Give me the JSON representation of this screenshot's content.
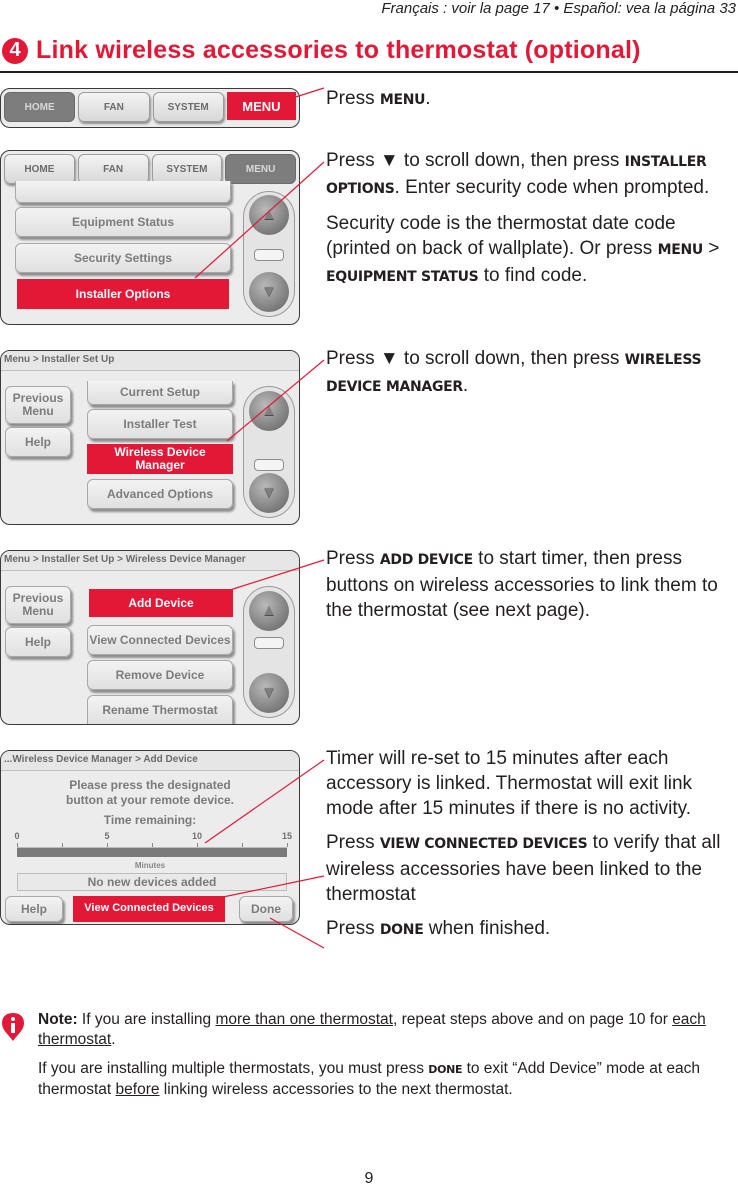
{
  "header": {
    "language_note": "Français : voir la page 17  •  Español: vea la página 33",
    "step_number": "4",
    "title": "Link wireless accessories to thermostat (optional)"
  },
  "screens": {
    "s1": {
      "tabs": [
        "HOME",
        "FAN",
        "SYSTEM",
        "MENU"
      ],
      "highlighted_tab": "MENU"
    },
    "s2": {
      "tabs": [
        "HOME",
        "FAN",
        "SYSTEM",
        "MENU"
      ],
      "items": [
        "",
        "Equipment Status",
        "Security Settings",
        "Installer Options"
      ],
      "highlighted_item": "Installer Options",
      "scroll_up": "▲",
      "scroll_down": "▼"
    },
    "s3": {
      "breadcrumb": "Menu > Installer Set Up",
      "side_buttons": [
        "Previous Menu",
        "Help"
      ],
      "items": [
        "Current Setup",
        "Installer Test",
        "Wireless Device Manager",
        "Advanced Options"
      ],
      "highlighted_item": "Wireless Device Manager",
      "scroll_up": "▲",
      "scroll_down": "▼"
    },
    "s4": {
      "breadcrumb": "Menu > Installer Set Up > Wireless Device Manager",
      "side_buttons": [
        "Previous Menu",
        "Help"
      ],
      "items": [
        "Add Device",
        "View Connected Devices",
        "Remove Device",
        "Rename Thermostat"
      ],
      "highlighted_item": "Add Device",
      "scroll_up": "▲",
      "scroll_down": "▼"
    },
    "s5": {
      "breadcrumb": "...Wireless Device Manager > Add Device",
      "prompt_line1": "Please press the designated",
      "prompt_line2": "button at your remote device.",
      "time_label": "Time remaining:",
      "scale_ticks": [
        "0",
        "5",
        "10",
        "15"
      ],
      "scale_unit": "Minutes",
      "time_remaining_minutes": 15,
      "status": "No new devices added",
      "buttons": [
        "Help",
        "View Connected Devices",
        "Done"
      ],
      "highlighted_button": "View Connected Devices"
    }
  },
  "instructions": {
    "i1": {
      "pre": "Press ",
      "kw": "MENU",
      "post": "."
    },
    "i2": {
      "pre": "Press ▼ to scroll down, then press ",
      "kw": "INSTALLER OPTIONS",
      "post": ". Enter security code when prompted."
    },
    "i3": {
      "pre": "Security code is the thermostat date code (printed on back of wallplate). Or press ",
      "kw1": "MENU",
      "sep": " > ",
      "kw2": "EQUIPMENT STATUS",
      "post": " to find code."
    },
    "i4": {
      "pre": "Press ▼ to scroll down, then press ",
      "kw": "WIRELESS DEVICE MANAGER",
      "post": "."
    },
    "i5": {
      "pre": "Press ",
      "kw": "ADD DEVICE",
      "post": " to start timer, then press buttons on wireless accessories to link them to the thermostat (see next page)."
    },
    "i6": {
      "text": "Timer will re-set to 15 minutes after each accessory is linked. Thermostat will exit link mode after 15 minutes if there is no activity."
    },
    "i7": {
      "pre": "Press ",
      "kw": "VIEW CONNECTED DEVICES",
      "post": " to verify that all wireless accessories have been linked to the thermostat"
    },
    "i8": {
      "pre": "Press ",
      "kw": "DONE",
      "post": " when finished."
    }
  },
  "note": {
    "label": "Note:",
    "p1_a": " If you are installing ",
    "p1_u1": "more than one thermostat",
    "p1_b": ", repeat steps above and on page 10 for ",
    "p1_u2": "each thermostat",
    "p1_c": ".",
    "p2_a": "If you are installing multiple thermostats, you must press ",
    "p2_kw": "DONE",
    "p2_b": " to exit “Add Device” mode at each thermostat ",
    "p2_u": "before",
    "p2_c": " linking wireless accessories to the next thermostat."
  },
  "footer": {
    "page_number": "9"
  },
  "colors": {
    "accent": "#e31837",
    "text": "#231f20",
    "screen_bg": "#ececec"
  }
}
